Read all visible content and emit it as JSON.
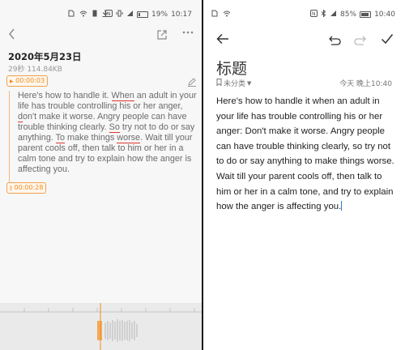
{
  "left": {
    "status": {
      "battery": "19%",
      "time": "10:17",
      "battery_level": 0.19
    },
    "date": "2020年5月23日",
    "meta": "29秒 114.84KB",
    "timestamp_start": "00:00:03",
    "timestamp_end": "00:00:28",
    "transcript": {
      "p1": "Here's how to handle it.",
      "u1": "When",
      "p2": " an adult in your life has trouble controlling his or her anger,",
      "u2": "d",
      "p3": "on't make it worse. Angry people can have trouble thinking clearly.",
      "u3": "So",
      "p4": " try not to do or say anything.",
      "u4": "To",
      "p5": " make things",
      "u5": "worse",
      "p6": ". Wait till your parent cools off, then talk to him or her in a calm tone and try to explain how the anger is affecting you."
    },
    "icons": {
      "back": "back-chevron-icon",
      "share": "share-icon",
      "more": "more-icon",
      "edit": "edit-pencil-icon"
    }
  },
  "right": {
    "status": {
      "battery": "85%",
      "time": "10:40",
      "battery_level": 0.85
    },
    "title": "标题",
    "category": "未分类",
    "time_label": "今天 晚上10:40",
    "body": "Here's how to handle it when an adult in your life has trouble controlling his or her anger: Don't make it worse. Angry people can have trouble thinking clearly, so try not to do or say anything to make things worse. Wait till your parent cools off, then talk to him or her in a calm tone, and try to explain how the anger is affecting you.",
    "icons": {
      "back": "back-arrow-icon",
      "undo": "undo-icon",
      "redo": "redo-icon",
      "done": "check-icon"
    }
  },
  "colors": {
    "accent_orange": "#f08c1e",
    "underline_red": "#d9362b",
    "caret_blue": "#2a7bd6"
  }
}
